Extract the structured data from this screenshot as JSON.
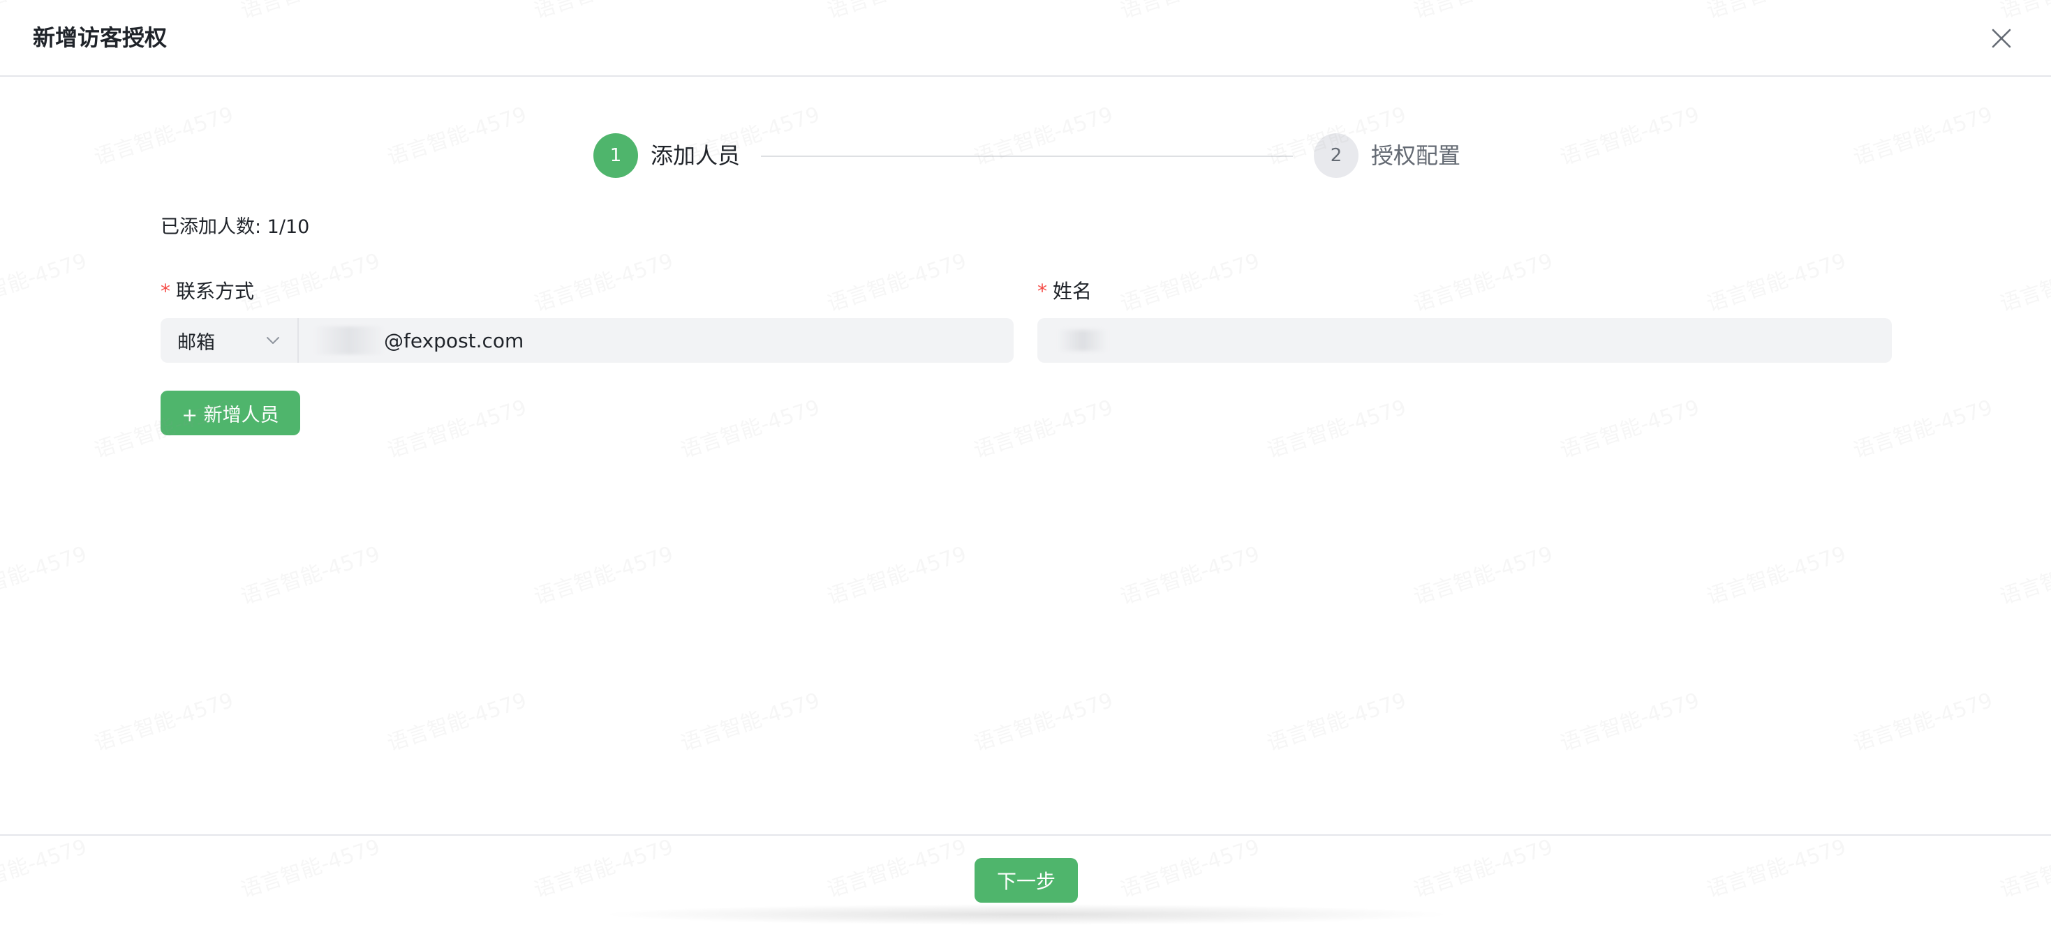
{
  "dialog": {
    "title": "新增访客授权",
    "close_icon": "close-icon"
  },
  "steps": [
    {
      "number": "1",
      "label": "添加人员",
      "status": "active"
    },
    {
      "number": "2",
      "label": "授权配置",
      "status": "pending"
    }
  ],
  "form": {
    "added_count_text": "已添加人数: 1/10",
    "contact": {
      "label": "联系方式",
      "required_mark": "*",
      "type_value": "邮箱",
      "email_domain": "@fexpost.com"
    },
    "name": {
      "label": "姓名",
      "required_mark": "*"
    },
    "add_button_label": "+ 新增人员"
  },
  "footer": {
    "next_button_label": "下一步"
  },
  "watermark_text": "语言智能-4579",
  "colors": {
    "primary": "#4fb56c",
    "required": "#f54a45",
    "input_bg": "#f2f3f5",
    "text": "#1f2329",
    "muted": "#646a73"
  }
}
